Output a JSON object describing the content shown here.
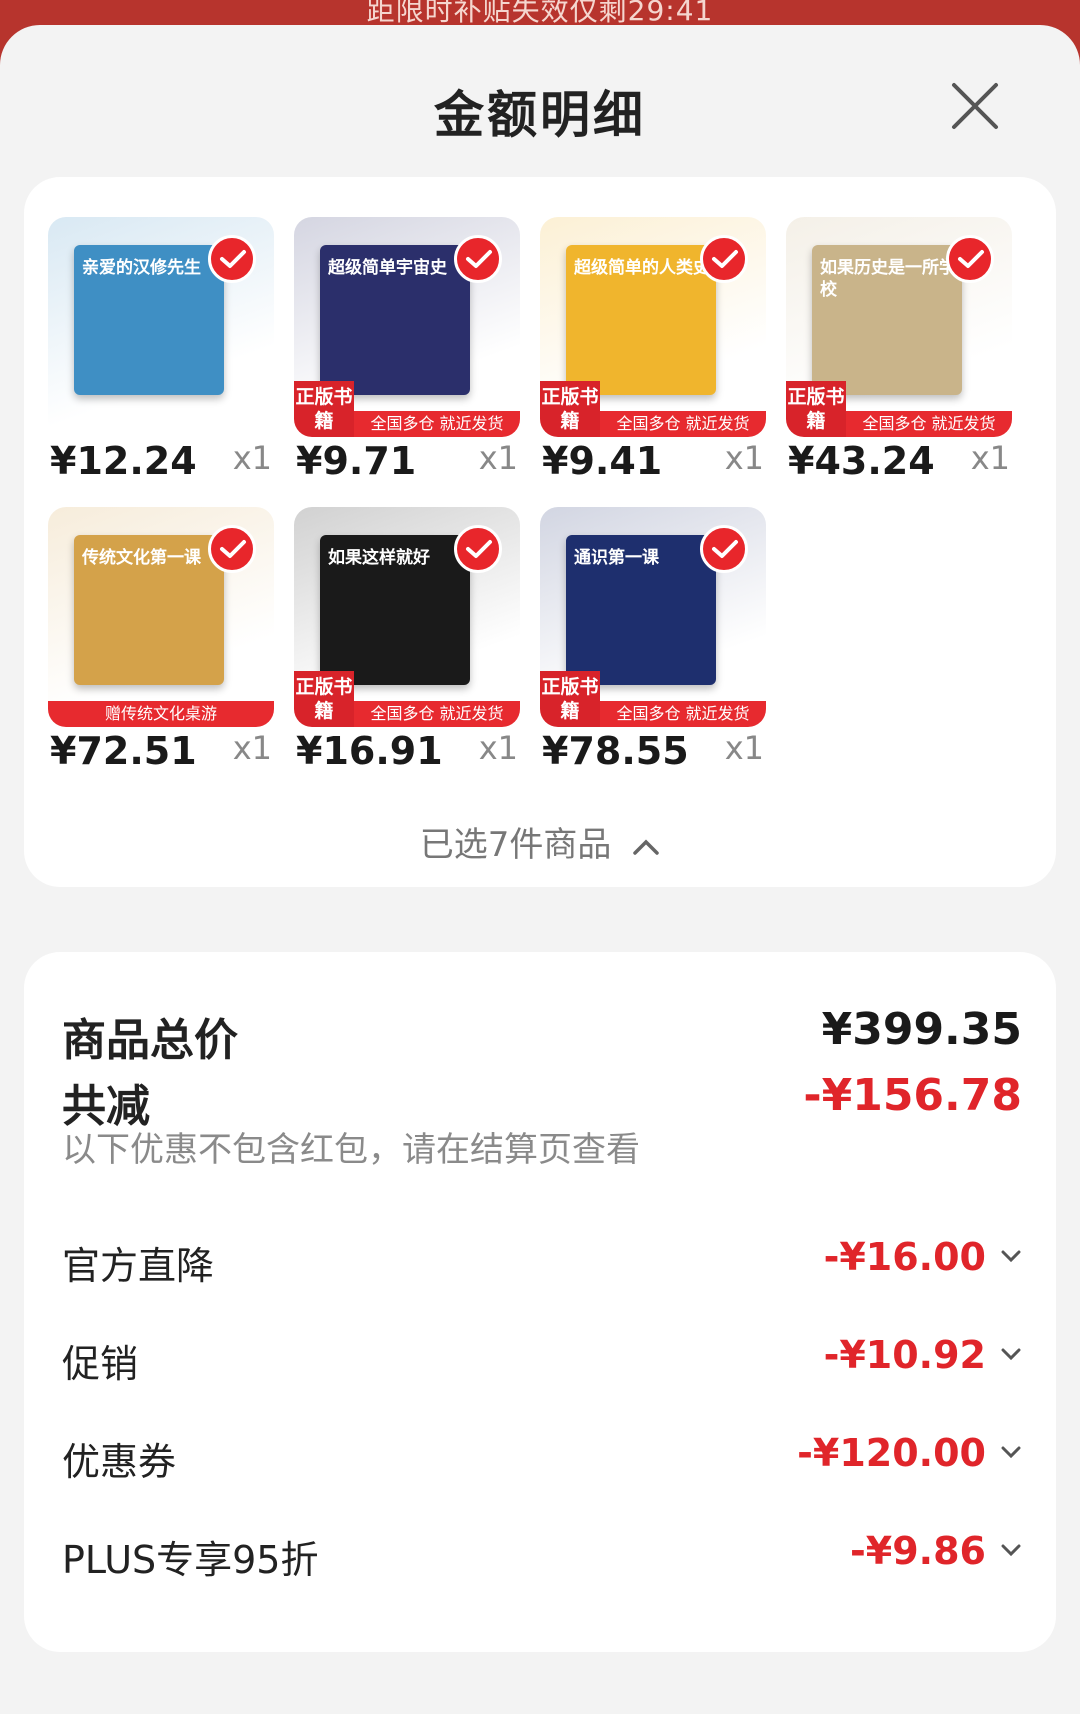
{
  "banner": {
    "text": "距限时补贴失效仅剩29:41"
  },
  "header": {
    "title": "金额明细"
  },
  "products": [
    {
      "price": "¥12.24",
      "qty": "x1",
      "book_title": "亲爱的汉修先生",
      "seal": "",
      "ribbon": "",
      "color": "#3f8fc4"
    },
    {
      "price": "¥9.71",
      "qty": "x1",
      "book_title": "超级简单宇宙史",
      "seal": "正版书籍",
      "ribbon": "全国多仓 就近发货",
      "color": "#2b2f6b"
    },
    {
      "price": "¥9.41",
      "qty": "x1",
      "book_title": "超级简单的人类史",
      "seal": "正版书籍",
      "ribbon": "全国多仓 就近发货",
      "color": "#f0b52d"
    },
    {
      "price": "¥43.24",
      "qty": "x1",
      "book_title": "如果历史是一所学校",
      "seal": "正版书籍",
      "ribbon": "全国多仓 就近发货",
      "color": "#c9b48a"
    },
    {
      "price": "¥72.51",
      "qty": "x1",
      "book_title": "传统文化第一课",
      "seal": "",
      "ribbon": "赠传统文化桌游",
      "color": "#d4a24a"
    },
    {
      "price": "¥16.91",
      "qty": "x1",
      "book_title": "如果这样就好",
      "seal": "正版书籍",
      "ribbon": "全国多仓 就近发货",
      "color": "#1a1a1a"
    },
    {
      "price": "¥78.55",
      "qty": "x1",
      "book_title": "通识第一课",
      "seal": "正版书籍",
      "ribbon": "全国多仓 就近发货",
      "color": "#1e2f6e"
    }
  ],
  "selected_summary": "已选7件商品",
  "summary": {
    "total_label": "商品总价",
    "total_value": "¥399.35",
    "reduce_label": "共减",
    "reduce_value": "-¥156.78",
    "note": "以下优惠不包含红包，请在结算页查看",
    "items": [
      {
        "label": "官方直降",
        "value": "-¥16.00"
      },
      {
        "label": "促销",
        "value": "-¥10.92"
      },
      {
        "label": "优惠券",
        "value": "-¥120.00"
      },
      {
        "label": "PLUS专享95折",
        "value": "-¥9.86"
      }
    ]
  },
  "colors": {
    "accent": "#e0252a",
    "background": "#f3f3f3"
  }
}
